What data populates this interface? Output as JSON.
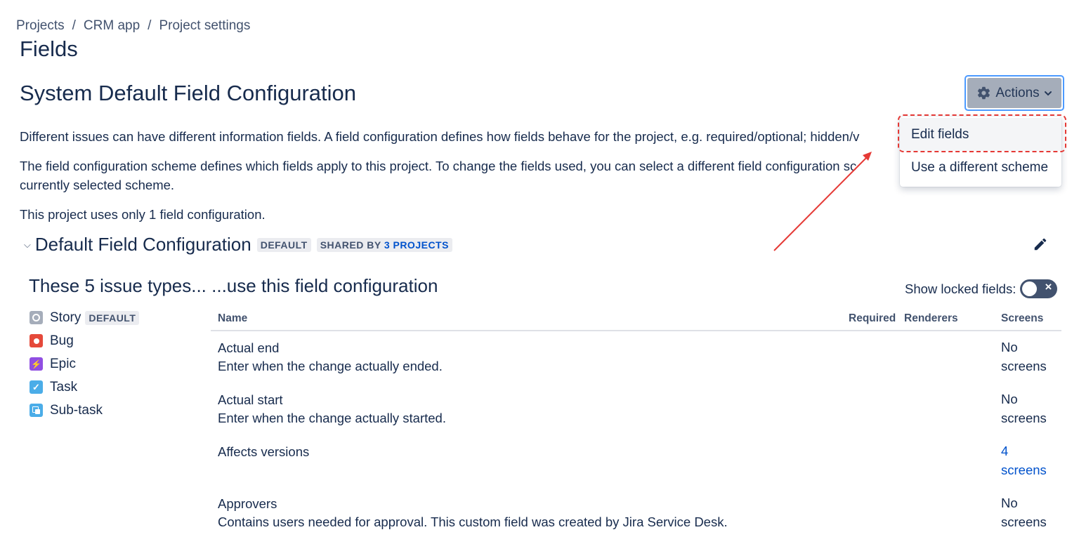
{
  "breadcrumb": {
    "items": [
      "Projects",
      "CRM app",
      "Project settings"
    ],
    "separator": "/"
  },
  "page_title": "Fields",
  "config_title": "System Default Field Configuration",
  "actions": {
    "label": "Actions",
    "icon": "gear-icon",
    "menu": [
      "Edit fields",
      "Use a different scheme"
    ]
  },
  "descriptions": {
    "line1": "Different issues can have different information fields. A field configuration defines how fields behave for the project, e.g. required/optional; hidden/v",
    "line2a": "The field configuration scheme defines which fields apply to this project. To change the fields used, you can select a different field configuration sc",
    "line2b": "currently selected scheme.",
    "line3": "This project uses only 1 field configuration."
  },
  "section": {
    "title": "Default Field Configuration",
    "default_badge": "DEFAULT",
    "shared_prefix": "SHARED BY",
    "shared_link": "3 PROJECTS"
  },
  "issue_types_heading": "These 5 issue types... ...use this field configuration",
  "show_locked_label": "Show locked fields:",
  "toggle_icon": "×",
  "issue_types": [
    {
      "name": "Story",
      "badge": "DEFAULT",
      "icon": "story-icon"
    },
    {
      "name": "Bug",
      "icon": "bug-icon"
    },
    {
      "name": "Epic",
      "icon": "epic-icon"
    },
    {
      "name": "Task",
      "icon": "task-icon"
    },
    {
      "name": "Sub-task",
      "icon": "subtask-icon"
    }
  ],
  "table": {
    "headers": {
      "name": "Name",
      "required": "Required",
      "renderers": "Renderers",
      "screens": "Screens"
    },
    "rows": [
      {
        "name": "Actual end",
        "description": "Enter when the change actually ended.",
        "screens": "No screens"
      },
      {
        "name": "Actual start",
        "description": "Enter when the change actually started.",
        "screens": "No screens"
      },
      {
        "name": "Affects versions",
        "description": "",
        "screens": "4 screens"
      },
      {
        "name": "Approvers",
        "description": "Contains users needed for approval. This custom field was created by Jira Service Desk.",
        "screens": "No screens"
      }
    ]
  },
  "colors": {
    "link": "#0052cc",
    "highlight": "#e53935",
    "text": "#172b4d"
  }
}
